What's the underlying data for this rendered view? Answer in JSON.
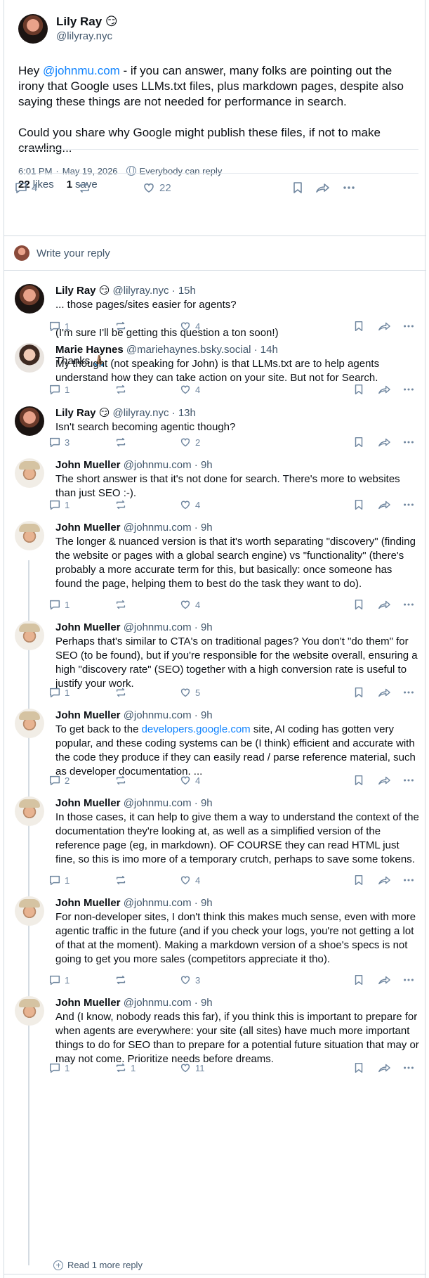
{
  "main_post": {
    "name": "Lily Ray 😏",
    "handle": "@lilyray.nyc",
    "text_prefix": "Hey ",
    "mention": "@johnmu.com",
    "text_suffix": " - if you can answer, many folks are pointing out the irony that Google uses LLMs.txt files, plus markdown pages, despite also saying these things are not needed for performance in search.\n\nCould you share why Google might publish these files, if not to make crawling...",
    "time": "6:01 PM",
    "date": "May 19, 2026",
    "reply_setting": "Everybody can reply",
    "likes_count": "22",
    "likes_label": "likes",
    "saves_count": "1",
    "saves_label": "save",
    "reply_count": "4",
    "like_count": "22"
  },
  "composer": {
    "placeholder": "Write your reply"
  },
  "replies": [
    {
      "name": "Lily Ray 😏",
      "handle": "@lilyray.nyc",
      "time": "15h",
      "text": "... those pages/sites easier for agents?\n\n(I'm sure I'll be getting this question a ton soon!)\n\nThanks 🙏🏽",
      "replies": "1",
      "reposts": "",
      "likes": "4"
    },
    {
      "name": "Marie Haynes",
      "handle": "@mariehaynes.bsky.social",
      "time": "14h",
      "text": "My thought (not speaking for John) is that LLMs.txt are to help agents understand how they can take action on your site. But not for Search.",
      "replies": "1",
      "reposts": "",
      "likes": "4"
    },
    {
      "name": "Lily Ray 😏",
      "handle": "@lilyray.nyc",
      "time": "13h",
      "text": "Isn't search becoming agentic though?",
      "replies": "3",
      "reposts": "",
      "likes": "2"
    },
    {
      "name": "John Mueller",
      "handle": "@johnmu.com",
      "time": "9h",
      "text": "The short answer is that it's not done for search. There's more to websites than just SEO :-).",
      "replies": "1",
      "reposts": "",
      "likes": "4"
    },
    {
      "name": "John Mueller",
      "handle": "@johnmu.com",
      "time": "9h",
      "text": "The longer & nuanced version is that it's worth separating \"discovery\" (finding the website or pages with a global search engine) vs \"functionality\" (there's probably a more accurate term for this, but basically: once someone has found the page, helping them to best do the task they want to do).",
      "replies": "1",
      "reposts": "",
      "likes": "4"
    },
    {
      "name": "John Mueller",
      "handle": "@johnmu.com",
      "time": "9h",
      "text": "Perhaps that's similar to CTA's on traditional pages? You don't \"do them\" for SEO (to be found), but if you're responsible for the website overall, ensuring a high \"discovery rate\" (SEO) together with a high conversion rate is useful to justify your work.",
      "replies": "1",
      "reposts": "",
      "likes": "5"
    },
    {
      "name": "John Mueller",
      "handle": "@johnmu.com",
      "time": "9h",
      "text_prefix": "To get back to the ",
      "link": "developers.google.com",
      "text": " site, AI coding has gotten very popular, and these coding systems can be (I think) efficient and accurate with the code they produce if they can easily read / parse reference material, such as developer documentation. ...",
      "replies": "2",
      "reposts": "",
      "likes": "4"
    },
    {
      "name": "John Mueller",
      "handle": "@johnmu.com",
      "time": "9h",
      "text": "In those cases, it can help to give them a way to understand the context of the documentation they're looking at, as well as a simplified version of the reference page (eg, in markdown). OF COURSE they can read HTML just fine, so this is imo more of a temporary crutch, perhaps to save some tokens.",
      "replies": "1",
      "reposts": "",
      "likes": "4"
    },
    {
      "name": "John Mueller",
      "handle": "@johnmu.com",
      "time": "9h",
      "text": "For non-developer sites, I don't think this makes much sense, even with more agentic traffic in the future (and if you check your logs, you're not getting a lot of that at the moment). Making a markdown version of a shoe's specs is not going to get you more sales (competitors appreciate it tho).",
      "replies": "1",
      "reposts": "",
      "likes": "3"
    },
    {
      "name": "John Mueller",
      "handle": "@johnmu.com",
      "time": "9h",
      "text": "And (I know, nobody reads this far), if you think this is important to prepare for when agents are everywhere: your site (all sites) have much more important things to do for SEO than to prepare for a potential future situation that may or may not come. Prioritize needs before dreams.",
      "replies": "1",
      "reposts": "1",
      "likes": "11"
    }
  ],
  "read_more": "Read 1 more reply",
  "icons": [
    "reply-icon",
    "repost-icon",
    "like-icon",
    "bookmark-icon",
    "share-icon",
    "more-icon",
    "globe-icon",
    "plus-icon"
  ],
  "colors": {
    "link": "#1083fe",
    "muted": "#42576c",
    "icon": "#6f869f",
    "border": "#d4dbe2"
  }
}
